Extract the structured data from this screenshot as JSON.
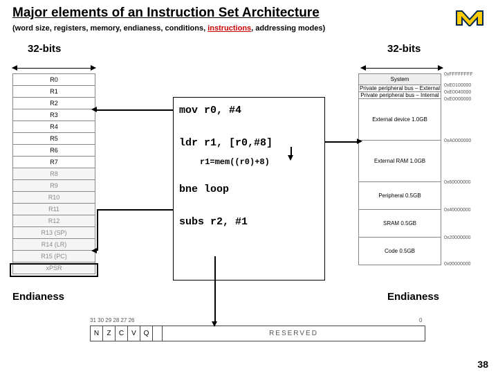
{
  "title": "Major elements of an Instruction Set Architecture",
  "subtitle_pre": "(word size, registers, memory, endianess, conditions, ",
  "subtitle_red": "instructions",
  "subtitle_post": ", addressing modes)",
  "bits_left": "32-bits",
  "bits_right": "32-bits",
  "endianess_left": "Endianess",
  "endianess_right": "Endianess",
  "registers": [
    "R0",
    "R1",
    "R2",
    "R3",
    "R4",
    "R5",
    "R6",
    "R7",
    "R8",
    "R9",
    "R10",
    "R11",
    "R12",
    "R13 (SP)",
    "R14 (LR)",
    "R15 (PC)",
    "xPSR"
  ],
  "code": {
    "mov": "mov r0, #4",
    "ldr": "ldr r1, [r0,#8]",
    "note": "r1=mem((r0)+8)",
    "bne": "bne loop",
    "subs": "subs r2, #1"
  },
  "memory": {
    "header": "System",
    "rows": [
      "Private peripheral bus – External",
      "Private peripheral bus – Internal",
      "External device   1.0GB",
      "External RAM   1.0GB",
      "Peripheral   0.5GB",
      "SRAM   0.5GB",
      "Code   0.5GB"
    ],
    "addresses": [
      "0xFFFFFFFF",
      "0xE0100000",
      "0xE0040000",
      "0xE0000000",
      "0xA0000000",
      "0x60000000",
      "0x40000000",
      "0x20000000",
      "0x00000000"
    ]
  },
  "flags": {
    "bits_hi": "31  30  29  28  27  26",
    "bits_lo": "0",
    "cells": [
      "N",
      "Z",
      "C",
      "V",
      "Q"
    ],
    "reserved": "RESERVED"
  },
  "page": "38"
}
